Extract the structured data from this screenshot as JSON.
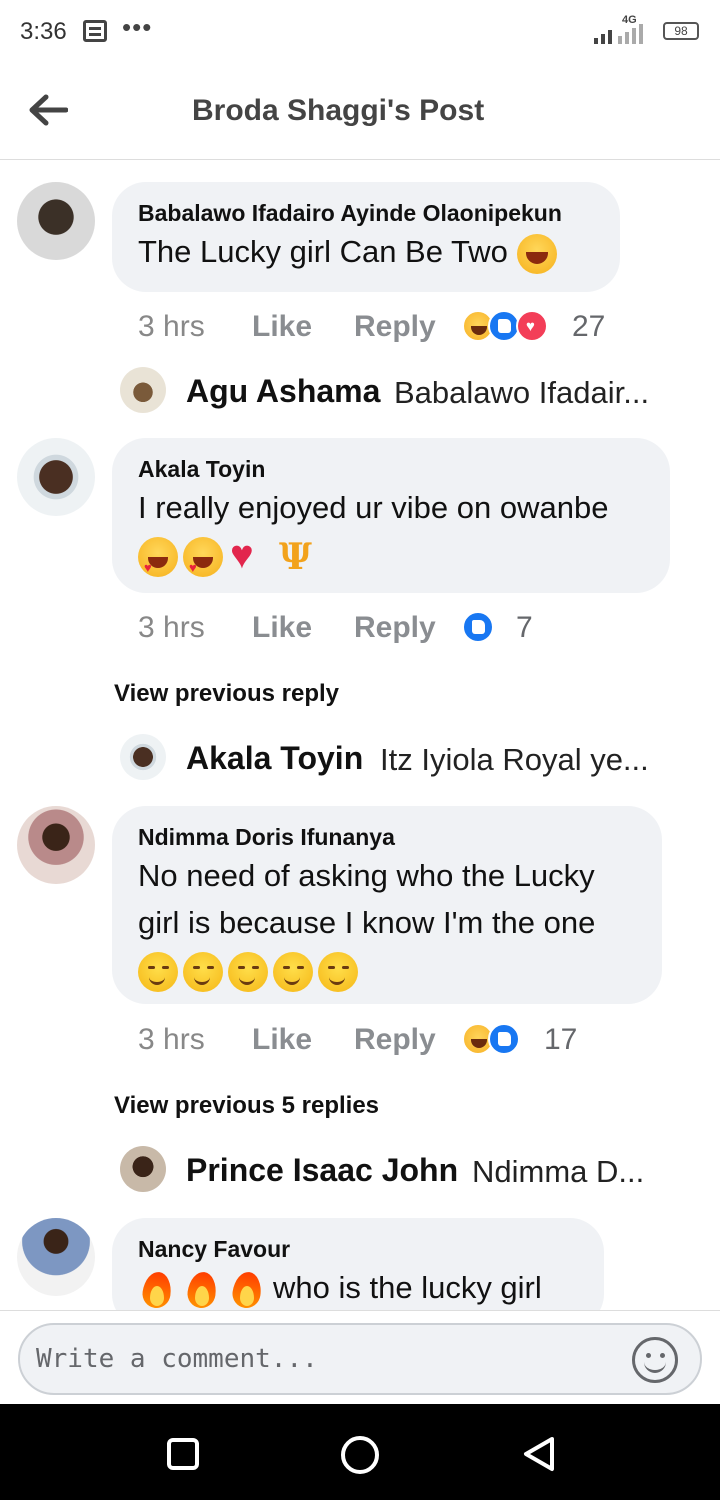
{
  "status": {
    "time": "3:36",
    "network": "4G",
    "battery": "98"
  },
  "header": {
    "title": "Broda Shaggi's Post"
  },
  "comments": [
    {
      "author": "Babalawo Ifadairo Ayinde Olaonipekun",
      "text": "The Lucky girl Can Be Two",
      "time": "3 hrs",
      "like": "Like",
      "reply": "Reply",
      "reactions": "27",
      "reply_preview": {
        "name": "Agu Ashama",
        "text": "Babalawo Ifadair..."
      }
    },
    {
      "author": "Akala Toyin",
      "text": "I really enjoyed ur vibe on owanbe",
      "time": "3 hrs",
      "like": "Like",
      "reply": "Reply",
      "reactions": "7",
      "view_previous": "View previous reply",
      "reply_preview": {
        "name": "Akala Toyin",
        "text": "Itz Iyiola Royal ye..."
      }
    },
    {
      "author": "Ndimma Doris Ifunanya",
      "text_line1": "No need of asking who the Lucky",
      "text_line2": "girl is because I know I'm the one",
      "time": "3 hrs",
      "like": "Like",
      "reply": "Reply",
      "reactions": "17",
      "view_previous": "View previous 5 replies",
      "reply_preview": {
        "name": "Prince Isaac John",
        "text": "Ndimma D..."
      }
    },
    {
      "author": "Nancy Favour",
      "text": "who is the lucky girl"
    }
  ],
  "composer": {
    "placeholder": "Write a comment..."
  },
  "icons": {
    "back": "back-arrow-icon",
    "emoji": "smiley-icon"
  },
  "colors": {
    "bubble": "#f0f2f5",
    "like_blue": "#1877f2",
    "love_red": "#f33e58"
  }
}
